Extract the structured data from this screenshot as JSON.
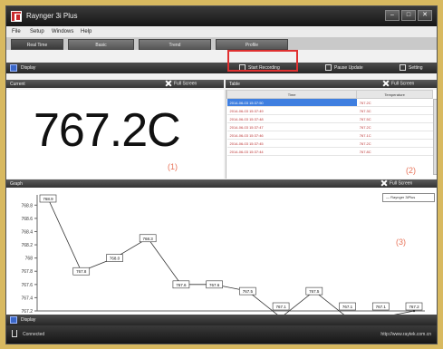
{
  "window": {
    "title": "Raynger 3i Plus"
  },
  "menu": [
    "File",
    "Setup",
    "Windows",
    "Help"
  ],
  "tabs": [
    "Real Time",
    "Basic",
    "Trend",
    "Profile"
  ],
  "display_bar": {
    "label": "Display",
    "start_recording": "Start Recording",
    "pause_update": "Pause Update",
    "setting": "Setting"
  },
  "current": {
    "header": "Current",
    "full_screen": "Full Screen",
    "value": "767.2C",
    "marker": "(1)"
  },
  "log": {
    "header": "Table",
    "full_screen": "Full Screen",
    "columns": [
      "Time",
      "Temperature"
    ],
    "rows": [
      [
        "2014-06-03 15:37:50",
        "767.2C"
      ],
      [
        "2014-06-03 15:37:49",
        "767.3C"
      ],
      [
        "2014-06-03 15:37:48",
        "767.5C"
      ],
      [
        "2014-06-03 15:37:47",
        "767.2C"
      ],
      [
        "2014-06-03 15:37:46",
        "767.1C"
      ],
      [
        "2014-06-03 15:37:45",
        "767.2C"
      ],
      [
        "2014-06-03 15:37:44",
        "767.8C"
      ]
    ],
    "marker": "(2)"
  },
  "graph": {
    "header": "Graph",
    "full_screen": "Full Screen",
    "marker": "(3)",
    "legend": "Raynger 3iPlus"
  },
  "bottom_bar": {
    "label": "Display"
  },
  "status": {
    "connection": "Connected",
    "url": "http://www.raytek.com.cn"
  },
  "colors": {
    "accent": "#3f7fe0",
    "highlight": "#e03030",
    "marker": "#e8745a"
  },
  "chart_data": {
    "type": "line",
    "x": [
      1,
      2,
      3,
      4,
      5,
      6,
      7,
      8,
      9,
      10,
      11,
      12
    ],
    "series": [
      {
        "name": "Raynger 3iPlus",
        "values": [
          768.9,
          767.8,
          768.0,
          768.3,
          767.6,
          767.6,
          767.5,
          767.1,
          767.5,
          767.1,
          767.1,
          767.2
        ]
      }
    ],
    "labels": [
      "768.9",
      "767.8",
      "768.0",
      "768.3",
      "767.6",
      "767.6",
      "767.5",
      "767.1",
      "767.5",
      "767.1",
      "767.1",
      "767.2"
    ],
    "yticks": [
      "767.2",
      "767.4",
      "767.6",
      "767.8",
      "768",
      "768.2",
      "768.4",
      "768.6",
      "768.8"
    ],
    "ylim": [
      767.2,
      768.9
    ],
    "grid": false,
    "legend": "top-right"
  }
}
